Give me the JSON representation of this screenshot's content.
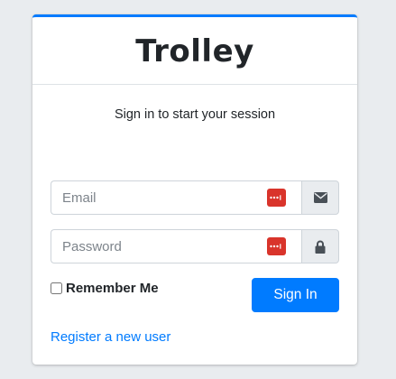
{
  "brand": {
    "title": "Trolley"
  },
  "login": {
    "message": "Sign in to start your session",
    "email_placeholder": "Email",
    "password_placeholder": "Password",
    "remember_label": "Remember Me",
    "submit_label": "Sign In",
    "register_link": "Register a new user"
  },
  "colors": {
    "accent": "#007bff",
    "password_manager": "#d9342b",
    "background": "#e9ecef"
  },
  "icons": {
    "email_addon": "envelope-icon",
    "password_addon": "lock-icon",
    "password_manager": "password-manager-icon"
  }
}
